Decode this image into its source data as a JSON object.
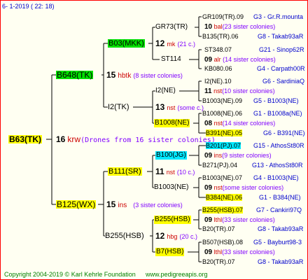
{
  "header": {
    "left": "6-  1-2019 (  22:  18)"
  },
  "footer": {
    "copyright": "Copyright 2004-2019 © Karl Kehrle Foundation",
    "site": "www.pedigreeapis.org"
  },
  "root": {
    "name": "B63(TK)",
    "count": "16",
    "breed": "krw",
    "note": "(Drones from 16 sister colonies)"
  },
  "g1": [
    {
      "name": "B648(TK)",
      "count": "15",
      "breed": "hbtk",
      "note": "(8 sister colonies)"
    },
    {
      "name": "B125(WX)",
      "count": "15",
      "breed": "ins",
      "note": "(3 sister colonies)"
    }
  ],
  "g2": [
    {
      "name": "B03(MKK)",
      "count": "12",
      "breed": "mk",
      "note": "(21 c.)"
    },
    {
      "name": "I2(TK)",
      "count": "13",
      "breed": "nst",
      "note": "(some c.)"
    },
    {
      "name": "B111(SR)",
      "count": "11",
      "breed": "nst",
      "note": "(10 c.)"
    },
    {
      "name": "B255(HSB)",
      "count": "12",
      "breed": "hbg",
      "note": "(20 c.)"
    }
  ],
  "g3": [
    {
      "name": "GR73(TR)",
      "count": "10",
      "breed": "bal",
      "note": "(23 sister colonies)"
    },
    {
      "name": "ST114",
      "count": "09",
      "breed": "alr",
      "note": "(14 sister colonies)"
    },
    {
      "name": "I2(NE)",
      "count": "11",
      "breed": "nst",
      "note": "(10 sister colonies)"
    },
    {
      "name": "B1008(NE)",
      "count": "08",
      "breed": "nst",
      "note": "(14 sister colonies)"
    },
    {
      "name": "B100(JG)",
      "count": "09",
      "breed": "ins",
      "note": "(9 sister colonies)"
    },
    {
      "name": "B1003(NE)",
      "count": "09",
      "breed": "nst",
      "note": "(some sister colonies)"
    },
    {
      "name": "B255(HSB)",
      "count": "09",
      "breed": "lthl",
      "note": "(33 sister colonies)"
    },
    {
      "name": "B7(HSB)",
      "count": "09",
      "breed": "lthl",
      "note": "(33 sister colonies)"
    }
  ],
  "g4": [
    {
      "name": "GR109(TR).09",
      "code": "G3 - Gr.R.mounta"
    },
    {
      "name": "B135(TR).06",
      "code": "G8 - Takab93aR"
    },
    {
      "name": "ST348.07",
      "code": "G21 - Sinop62R"
    },
    {
      "name": "KB080.06",
      "code": "G4 - Carpath00R"
    },
    {
      "name": "I2(NE).10",
      "code": "G6 - SardiniaQ"
    },
    {
      "name": "B1003(NE).09",
      "code": "G5 - B1003(NE)"
    },
    {
      "name": "B1008(NE).06",
      "code": "G1 - B1008a(NE)"
    },
    {
      "name": "B391(NE).05",
      "code": "G6 - B391(NE)"
    },
    {
      "name": "B201(PJ).07",
      "code": "G15 - AthosSt80R"
    },
    {
      "name": "B271(PJ).04",
      "code": "G13 - AthosSt80R"
    },
    {
      "name": "B1003(NE).07",
      "code": "G4 - B1003(NE)"
    },
    {
      "name": "B384(NE).06",
      "code": "G1 - B384(NE)"
    },
    {
      "name": "B255(HSB).07",
      "code": "G7 - Cankiri97Q"
    },
    {
      "name": "B20(TR).07",
      "code": "G8 - Takab93aR"
    },
    {
      "name": "B507(HSB).08",
      "code": "G5 - Bayburt98-3"
    },
    {
      "name": "B20(TR).07",
      "code": "G8 - Takab93aR"
    }
  ]
}
